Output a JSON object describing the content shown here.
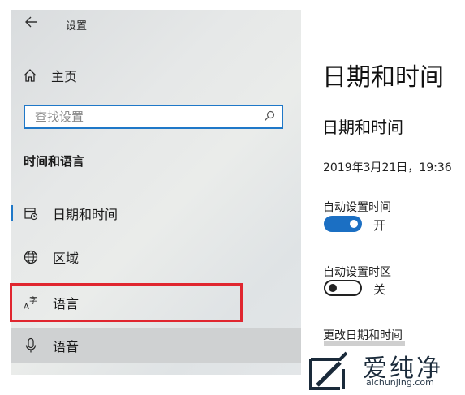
{
  "app": {
    "back_icon": "back-arrow-icon",
    "title": "设置"
  },
  "sidebar": {
    "home": {
      "icon": "home-icon",
      "label": "主页"
    },
    "search": {
      "placeholder": "查找设置",
      "icon": "search-icon"
    },
    "section_title": "时间和语言",
    "items": [
      {
        "icon": "date-time-icon",
        "label": "日期和时间",
        "active": true
      },
      {
        "icon": "globe-icon",
        "label": "区域"
      },
      {
        "icon": "language-icon",
        "label": "语言",
        "highlighted": true
      },
      {
        "icon": "microphone-icon",
        "label": "语音"
      }
    ],
    "highlight_color": "#e0262f",
    "accent_color": "#1f78c8"
  },
  "main": {
    "page_title": "日期和时间",
    "section_title": "日期和时间",
    "current_datetime": "2019年3月21日，19:36",
    "auto_time": {
      "label": "自动设置时间",
      "state": "开",
      "on": true
    },
    "auto_timezone": {
      "label": "自动设置时区",
      "state": "关",
      "on": false
    },
    "change_label": "更改日期和时间"
  },
  "watermark": {
    "text": "爱纯净",
    "url": "aichunjing.com"
  }
}
